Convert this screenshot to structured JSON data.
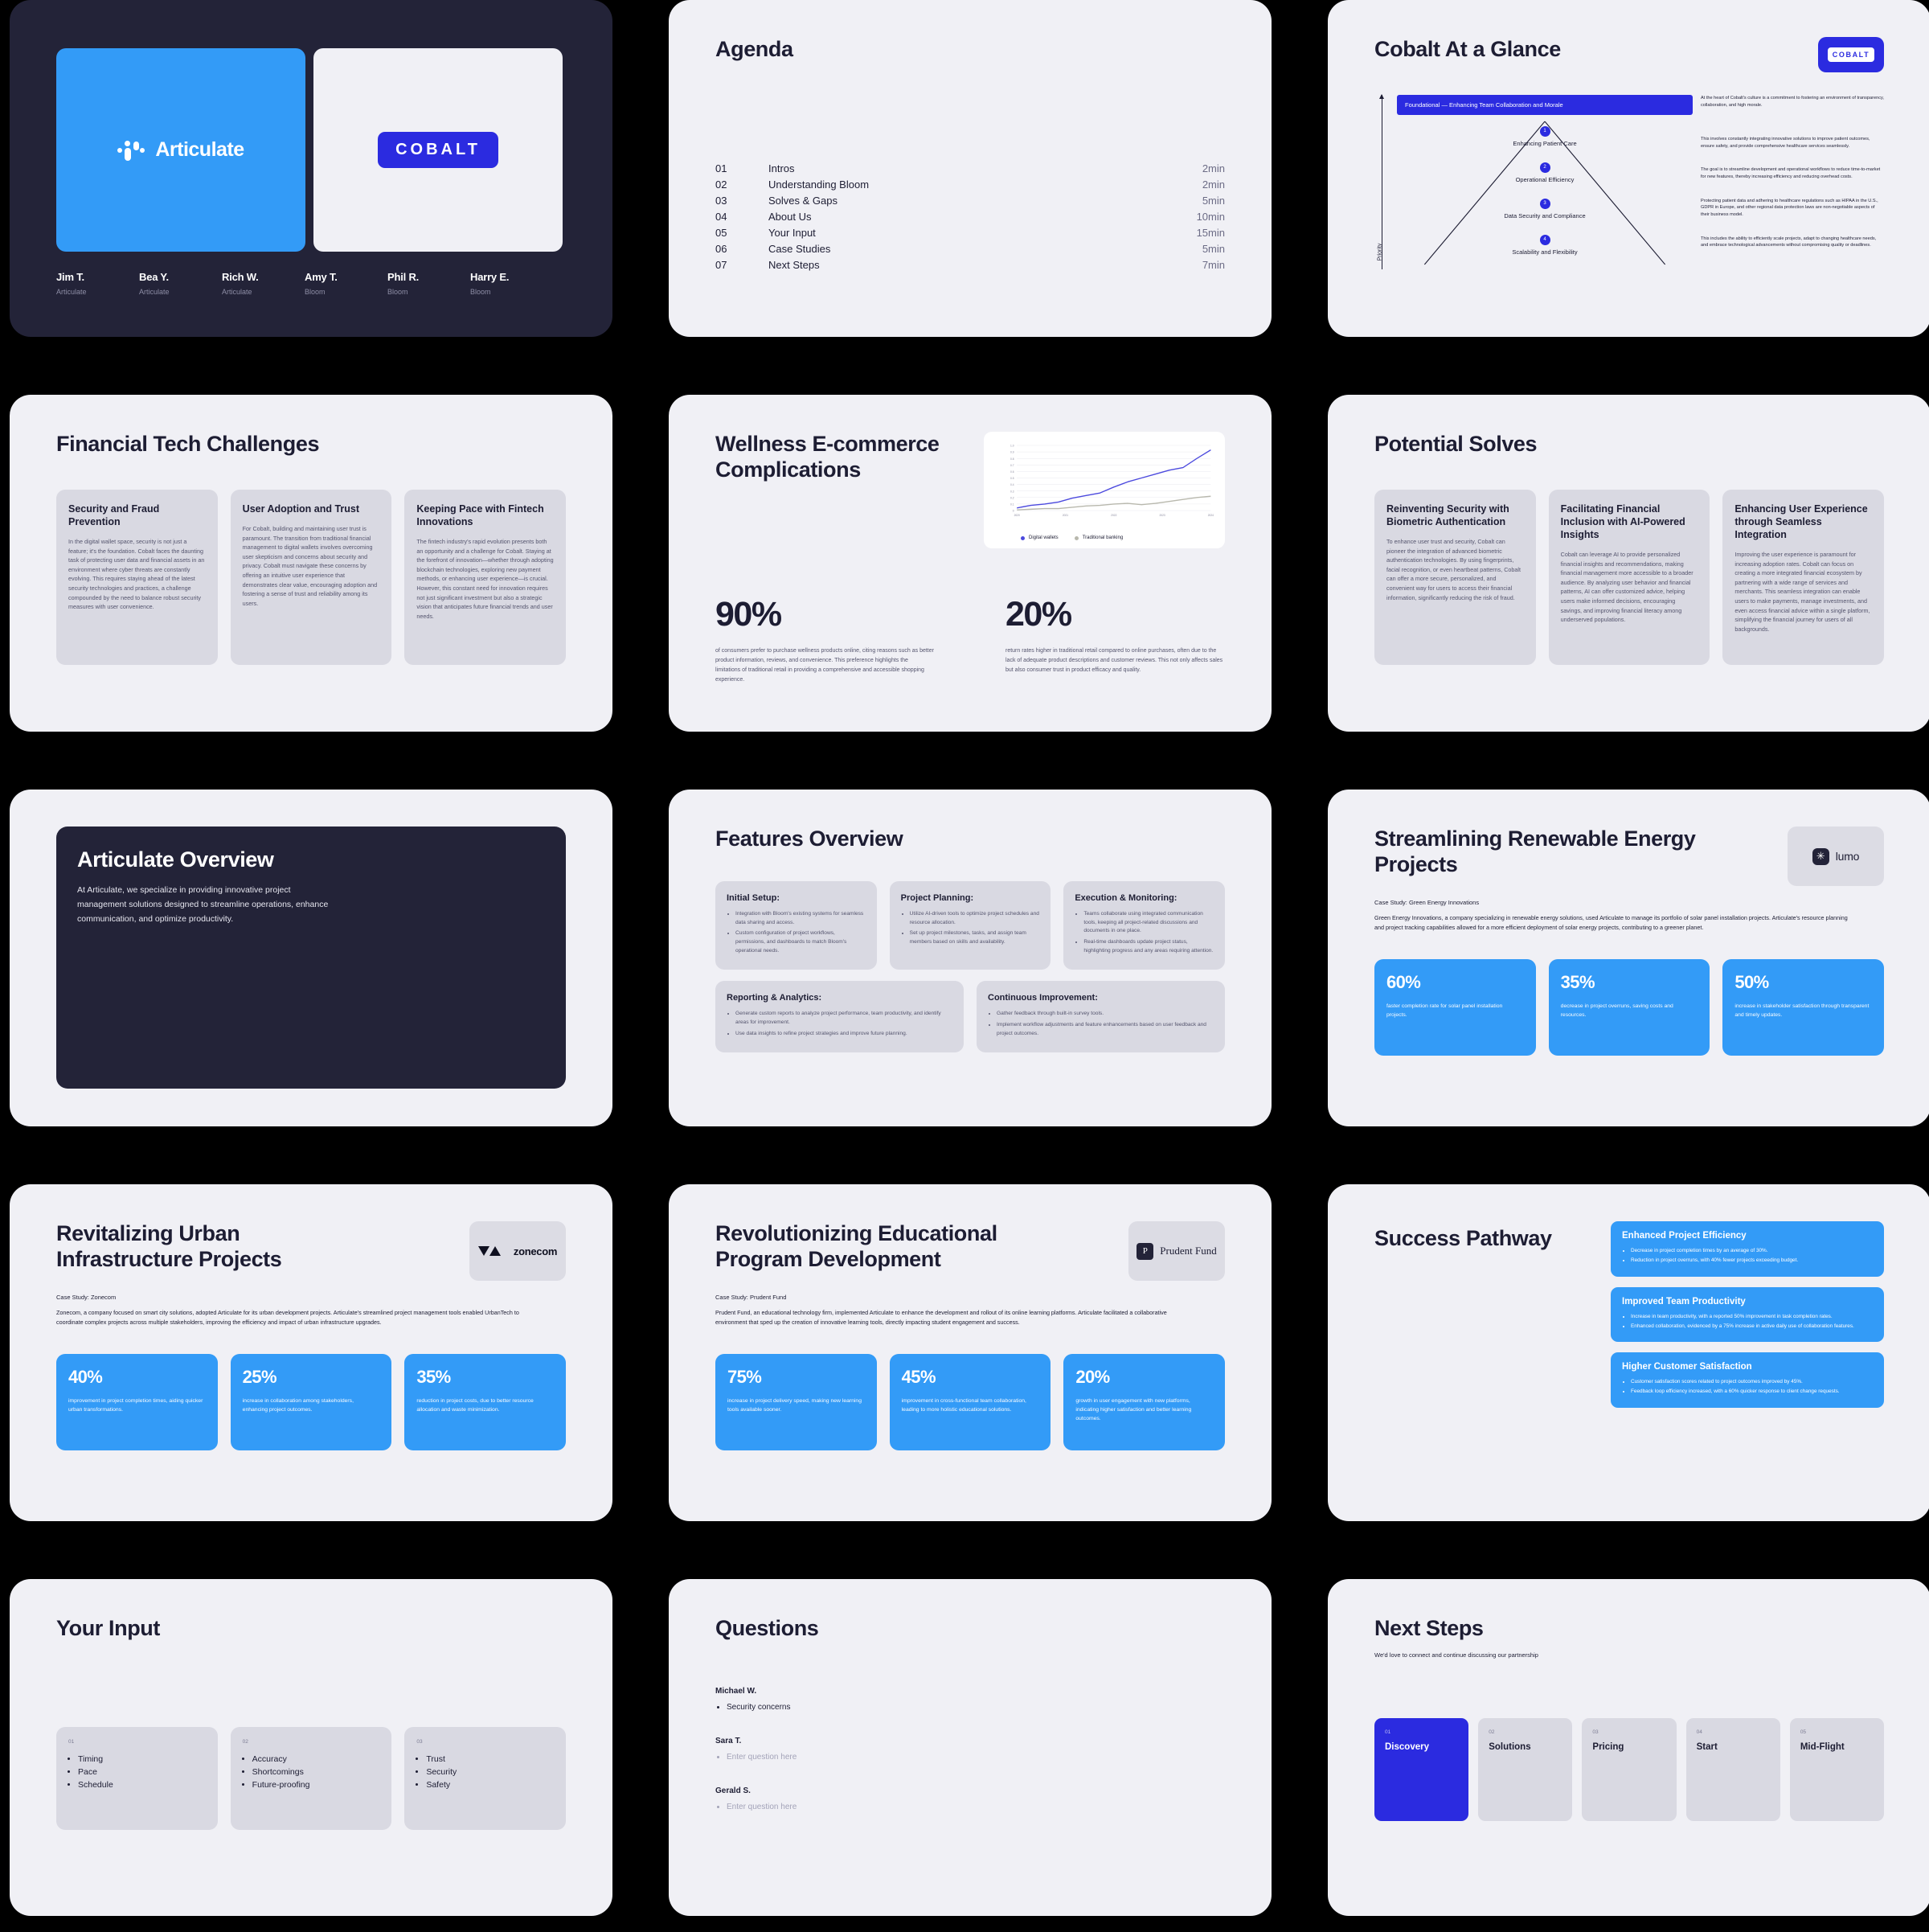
{
  "colors": {
    "deck_bg": "#000000",
    "slide_bg": "#f0f0f5",
    "slide_dark_bg": "#232338",
    "accent_blue": "#339bf7",
    "accent_indigo": "#2b2be0",
    "card_grey": "#d9d9e2",
    "ink": "#1d1d33"
  },
  "cover": {
    "articulate_logo": "Articulate",
    "cobalt_logo": "COBALT",
    "people": [
      {
        "name": "Jim T.",
        "org": "Articulate"
      },
      {
        "name": "Bea Y.",
        "org": "Articulate"
      },
      {
        "name": "Rich W.",
        "org": "Articulate"
      },
      {
        "name": "Amy T.",
        "org": "Bloom"
      },
      {
        "name": "Phil R.",
        "org": "Bloom"
      },
      {
        "name": "Harry E.",
        "org": "Bloom"
      }
    ]
  },
  "agenda": {
    "title": "Agenda",
    "items": [
      {
        "num": "01",
        "label": "Intros",
        "time": "2min"
      },
      {
        "num": "02",
        "label": "Understanding Bloom",
        "time": "2min"
      },
      {
        "num": "03",
        "label": "Solves & Gaps",
        "time": "5min"
      },
      {
        "num": "04",
        "label": "About Us",
        "time": "10min"
      },
      {
        "num": "05",
        "label": "Your Input",
        "time": "15min"
      },
      {
        "num": "06",
        "label": "Case Studies",
        "time": "5min"
      },
      {
        "num": "07",
        "label": "Next Steps",
        "time": "7min"
      }
    ]
  },
  "glance": {
    "title": "Cobalt At a Glance",
    "badge": "COBALT",
    "axis_label": "Priority",
    "foundational_label": "Foundational — Enhancing Team Collaboration and Morale",
    "foundational_desc": "At the heart of Cobalt's culture is a commitment to fostering an environment of transparency, collaboration, and high morale.",
    "steps": [
      {
        "num": "1",
        "name": "Enhancing Patient Care",
        "desc": "This involves constantly integrating innovative solutions to improve patient outcomes, ensure safety, and provide comprehensive healthcare services seamlessly."
      },
      {
        "num": "2",
        "name": "Operational Efficiency",
        "desc": "The goal is to streamline development and operational workflows to reduce time-to-market for new features, thereby increasing efficiency and reducing overhead costs."
      },
      {
        "num": "3",
        "name": "Data Security and Compliance",
        "desc": "Protecting patient data and adhering to healthcare regulations such as HIPAA in the U.S., GDPR in Europe, and other regional data protection laws are non-negotiable aspects of their business model."
      },
      {
        "num": "4",
        "name": "Scalability and Flexibility",
        "desc": "This includes the ability to efficiently scale projects, adapt to changing healthcare needs, and embrace technological advancements without compromising quality or deadlines."
      }
    ]
  },
  "challenges": {
    "title": "Financial Tech Challenges",
    "cards": [
      {
        "heading": "Security and Fraud Prevention",
        "body": "In the digital wallet space, security is not just a feature; it's the foundation. Cobalt faces the daunting task of protecting user data and financial assets in an environment where cyber threats are constantly evolving. This requires staying ahead of the latest security technologies and practices, a challenge compounded by the need to balance robust security measures with user convenience."
      },
      {
        "heading": "User Adoption and Trust",
        "body": "For Cobalt, building and maintaining user trust is paramount. The transition from traditional financial management to digital wallets involves overcoming user skepticism and concerns about security and privacy. Cobalt must navigate these concerns by offering an intuitive user experience that demonstrates clear value, encouraging adoption and fostering a sense of trust and reliability among its users."
      },
      {
        "heading": "Keeping Pace with Fintech Innovations",
        "body": "The fintech industry's rapid evolution presents both an opportunity and a challenge for Cobalt. Staying at the forefront of innovation—whether through adopting blockchain technologies, exploring new payment methods, or enhancing user experience—is crucial. However, this constant need for innovation requires not just significant investment but also a strategic vision that anticipates future financial trends and user needs."
      }
    ]
  },
  "wellness": {
    "title": "Wellness E-commerce Complications",
    "stats": [
      {
        "value": "90%",
        "desc": "of consumers prefer to purchase wellness products online, citing reasons such as better product information, reviews, and convenience. This preference highlights the limitations of traditional retail in providing a comprehensive and accessible shopping experience."
      },
      {
        "value": "20%",
        "desc": "return rates higher in traditional retail compared to online purchases, often due to the lack of adequate product descriptions and customer reviews. This not only affects sales but also consumer trust in product efficacy and quality."
      }
    ]
  },
  "chart_data": {
    "type": "line",
    "title": "",
    "xlabel": "",
    "ylabel": "",
    "x": [
      "2020",
      "2021",
      "2022",
      "2023",
      "2024"
    ],
    "ylim": [
      0,
      1.0
    ],
    "ytick_labels": [
      "0",
      "0.1",
      "0.2",
      "0.3",
      "0.4",
      "0.5",
      "0.6",
      "0.7",
      "0.8",
      "0.9",
      "1.0"
    ],
    "grid": true,
    "legend_position": "bottom-left",
    "series": [
      {
        "name": "Digital wallets",
        "color": "#4b49de",
        "values": [
          0.04,
          0.08,
          0.1,
          0.13,
          0.19,
          0.23,
          0.27,
          0.36,
          0.44,
          0.5,
          0.56,
          0.62,
          0.66,
          0.8,
          0.93
        ]
      },
      {
        "name": "Traditional banking",
        "color": "#b8b8ad",
        "values": [
          0.01,
          0.02,
          0.03,
          0.03,
          0.05,
          0.07,
          0.08,
          0.1,
          0.11,
          0.09,
          0.11,
          0.14,
          0.17,
          0.2,
          0.22
        ]
      }
    ]
  },
  "solves": {
    "title": "Potential Solves",
    "cards": [
      {
        "heading": "Reinventing Security with Biometric Authentication",
        "body": "To enhance user trust and security, Cobalt can pioneer the integration of advanced biometric authentication technologies. By using fingerprints, facial recognition, or even heartbeat patterns, Cobalt can offer a more secure, personalized, and convenient way for users to access their financial information, significantly reducing the risk of fraud."
      },
      {
        "heading": "Facilitating Financial Inclusion with AI-Powered Insights",
        "body": "Cobalt can leverage AI to provide personalized financial insights and recommendations, making financial management more accessible to a broader audience. By analyzing user behavior and financial patterns, AI can offer customized advice, helping users make informed decisions, encouraging savings, and improving financial literacy among underserved populations."
      },
      {
        "heading": "Enhancing User Experience through Seamless Integration",
        "body": "Improving the user experience is paramount for increasing adoption rates. Cobalt can focus on creating a more integrated financial ecosystem by partnering with a wide range of services and merchants. This seamless integration can enable users to make payments, manage investments, and even access financial advice within a single platform, simplifying the financial journey for users of all backgrounds."
      }
    ]
  },
  "overview": {
    "title": "Articulate Overview",
    "body": "At Articulate, we specialize in providing innovative project management solutions designed to streamline operations, enhance communication, and optimize productivity."
  },
  "features": {
    "title": "Features Overview",
    "cards": [
      {
        "heading": "Initial Setup:",
        "bullets": [
          "Integration with Bloom's existing systems for seamless data sharing and access.",
          "Custom configuration of project workflows, permissions, and dashboards to match Bloom's operational needs."
        ]
      },
      {
        "heading": "Project Planning:",
        "bullets": [
          "Utilize AI-driven tools to optimize project schedules and resource allocation.",
          "Set up project milestones, tasks, and assign team members based on skills and availability."
        ]
      },
      {
        "heading": "Execution & Monitoring:",
        "bullets": [
          "Teams collaborate using integrated communication tools, keeping all project-related discussions and documents in one place.",
          "Real-time dashboards update project status, highlighting progress and any areas requiring attention."
        ]
      },
      {
        "heading": "Reporting & Analytics:",
        "bullets": [
          "Generate custom reports to analyze project performance, team productivity, and identify areas for improvement.",
          "Use data insights to refine project strategies and improve future planning."
        ]
      },
      {
        "heading": "Continuous Improvement:",
        "bullets": [
          "Gather feedback through built-in survey tools.",
          "Implement workflow adjustments and feature enhancements based on user feedback and project outcomes."
        ]
      }
    ]
  },
  "renewable": {
    "title": "Streamlining Renewable Energy Projects",
    "logo": "lumo",
    "case_label": "Case Study: Green Energy Innovations",
    "body": "Green Energy Innovations, a company specializing in renewable energy solutions, used Articulate to manage its portfolio of solar panel installation projects. Articulate's resource planning and project tracking capabilities allowed for a more efficient deployment of solar energy projects, contributing to a greener planet.",
    "stats": [
      {
        "value": "60%",
        "desc": "faster completion rate for solar panel installation projects."
      },
      {
        "value": "35%",
        "desc": "decrease in project overruns, saving costs and resources."
      },
      {
        "value": "50%",
        "desc": "increase in stakeholder satisfaction through transparent and timely updates."
      }
    ]
  },
  "urban": {
    "title": "Revitalizing Urban Infrastructure Projects",
    "logo": "zonecom",
    "case_label": "Case Study: Zonecom",
    "body": "Zonecom, a company focused on smart city solutions, adopted Articulate for its urban development projects. Articulate's streamlined project management tools enabled UrbanTech to coordinate complex projects across multiple stakeholders, improving the efficiency and impact of urban infrastructure upgrades.",
    "stats": [
      {
        "value": "40%",
        "desc": "improvement in project completion times, aiding quicker urban transformations."
      },
      {
        "value": "25%",
        "desc": "increase in collaboration among stakeholders, enhancing project outcomes."
      },
      {
        "value": "35%",
        "desc": "reduction in project costs, due to better resource allocation and waste minimization."
      }
    ]
  },
  "education": {
    "title": "Revolutionizing Educational Program Development",
    "logo": "Prudent Fund",
    "logo_initial": "P",
    "case_label": "Case Study: Prudent Fund",
    "body": "Prudent Fund, an educational technology firm, implemented Articulate to enhance the development and rollout of its online learning platforms. Articulate facilitated a collaborative environment that sped up the creation of innovative learning tools, directly impacting student engagement and success.",
    "stats": [
      {
        "value": "75%",
        "desc": "increase in project delivery speed, making new learning tools available sooner."
      },
      {
        "value": "45%",
        "desc": "improvement in cross-functional team collaboration, leading to more holistic educational solutions."
      },
      {
        "value": "20%",
        "desc": "growth in user engagement with new platforms, indicating higher satisfaction and better learning outcomes."
      }
    ]
  },
  "pathway": {
    "title": "Success Pathway",
    "cards": [
      {
        "heading": "Enhanced Project Efficiency",
        "bullets": [
          "Decrease in project completion times by an average of 30%.",
          "Reduction in project overruns, with 40% fewer projects exceeding budget."
        ]
      },
      {
        "heading": "Improved Team Productivity",
        "bullets": [
          "Increase in team productivity, with a reported 50% improvement in task completion rates.",
          "Enhanced collaboration, evidenced by a 75% increase in active daily use of collaboration features."
        ]
      },
      {
        "heading": "Higher Customer Satisfaction",
        "bullets": [
          "Customer satisfaction scores related to project outcomes improved by 45%.",
          "Feedback loop efficiency increased, with a 60% quicker response to client change requests."
        ]
      }
    ]
  },
  "your_input": {
    "title": "Your Input",
    "cards": [
      {
        "num": "01",
        "items": [
          "Timing",
          "Pace",
          "Schedule"
        ]
      },
      {
        "num": "02",
        "items": [
          "Accuracy",
          "Shortcomings",
          "Future-proofing"
        ]
      },
      {
        "num": "03",
        "items": [
          "Trust",
          "Security",
          "Safety"
        ]
      }
    ]
  },
  "questions": {
    "title": "Questions",
    "placeholder": "Enter question here",
    "blocks": [
      {
        "name": "Michael W.",
        "answer": "Security concerns",
        "is_placeholder": false
      },
      {
        "name": "Sara T.",
        "answer": "Enter question here",
        "is_placeholder": true
      },
      {
        "name": "Gerald S.",
        "answer": "Enter question here",
        "is_placeholder": true
      }
    ]
  },
  "next_steps": {
    "title": "Next Steps",
    "subtitle": "We'd love to connect and continue discussing our partnership",
    "cards": [
      {
        "num": "01",
        "label": "Discovery",
        "active": true
      },
      {
        "num": "02",
        "label": "Solutions",
        "active": false
      },
      {
        "num": "03",
        "label": "Pricing",
        "active": false
      },
      {
        "num": "04",
        "label": "Start",
        "active": false
      },
      {
        "num": "05",
        "label": "Mid-Flight",
        "active": false
      }
    ]
  }
}
